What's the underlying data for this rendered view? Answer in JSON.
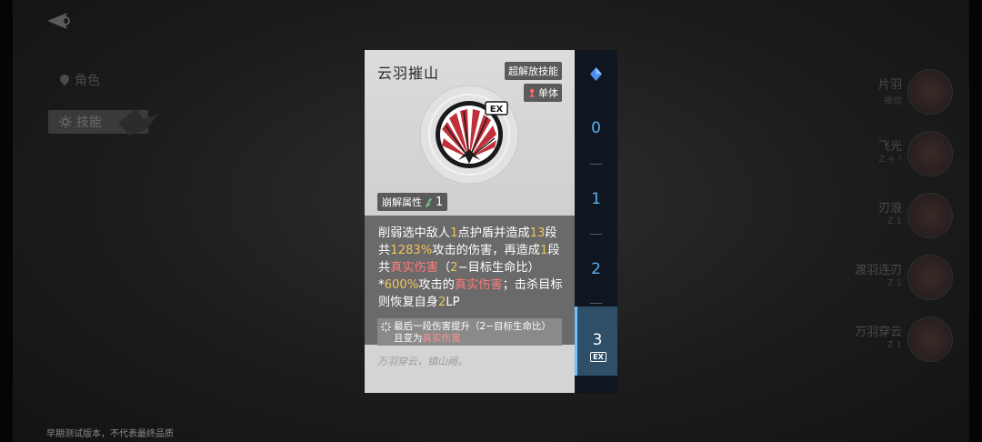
{
  "background": {
    "nav": {
      "role_label": "角色",
      "skill_label": "技能"
    },
    "right_list": [
      {
        "name": "片羽",
        "sub": "被动"
      },
      {
        "name": "飞光",
        "sub": "Z + ¹"
      },
      {
        "name": "刃浪",
        "sub": "Z  1"
      },
      {
        "name": "渡羽连刃",
        "sub": "Z  1"
      },
      {
        "name": "万羽穿云",
        "sub": "Z  1"
      }
    ],
    "footer_note": "早期测试版本，不代表最终品质"
  },
  "card": {
    "title": "云羽摧山",
    "tag_ult": "超解放技能",
    "tag_target": "单体",
    "ex_badge": "EX",
    "break_label": "崩解属性",
    "break_value": "1",
    "desc": {
      "p1": "削弱选中敌人",
      "n1": "1",
      "p2": "点护盾并造成",
      "n2": "13",
      "p3": "段共",
      "n3": "1283%",
      "p4": "攻击的伤害，再造成",
      "n4": "1",
      "p5": "段共",
      "r1": "真实伤害",
      "p6": "（",
      "n5": "2",
      "p7": "−目标生命比）*",
      "n6": "600%",
      "p8": "攻击的",
      "r2": "真实伤害",
      "p9": "；击杀目标则恢复自身",
      "n7": "2",
      "p10": "LP"
    },
    "note": {
      "t1": "最后一段伤害提升（2−目标生命比）且变为",
      "r": "真实伤害"
    },
    "flavor": "万羽穿云，镇山阙。"
  },
  "levels": {
    "items": [
      "0",
      "1",
      "2"
    ],
    "active": "3",
    "active_badge": "EX"
  },
  "colors": {
    "highlight_number": "#f0c35a",
    "highlight_true_damage": "#ff7a7a",
    "level_accent": "#5ab0ee"
  }
}
